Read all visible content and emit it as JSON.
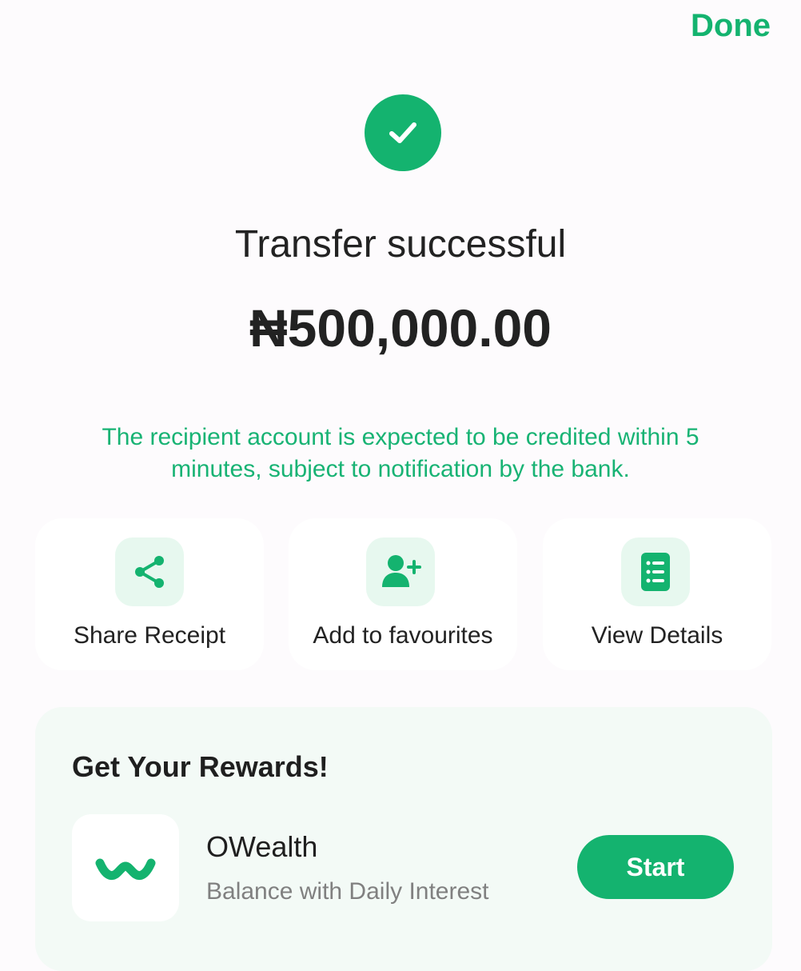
{
  "header": {
    "done_label": "Done"
  },
  "status": {
    "icon": "check-icon",
    "title": "Transfer successful",
    "amount": "₦500,000.00",
    "notice": "The recipient account is expected to be credited within 5 minutes, subject to notification by the bank."
  },
  "actions": [
    {
      "label": "Share Receipt",
      "icon": "share-icon"
    },
    {
      "label": "Add to favourites",
      "icon": "add-user-icon"
    },
    {
      "label": "View Details",
      "icon": "document-list-icon"
    }
  ],
  "rewards": {
    "title": "Get Your Rewards!",
    "product_name": "OWealth",
    "product_subtitle": "Balance with Daily Interest",
    "start_label": "Start",
    "logo_icon": "owealth-logo-icon"
  },
  "colors": {
    "brand_green": "#14b36f",
    "notice_green": "#18b374",
    "icon_tile_bg": "#e7f8ef",
    "rewards_bg": "#f3faf6"
  }
}
